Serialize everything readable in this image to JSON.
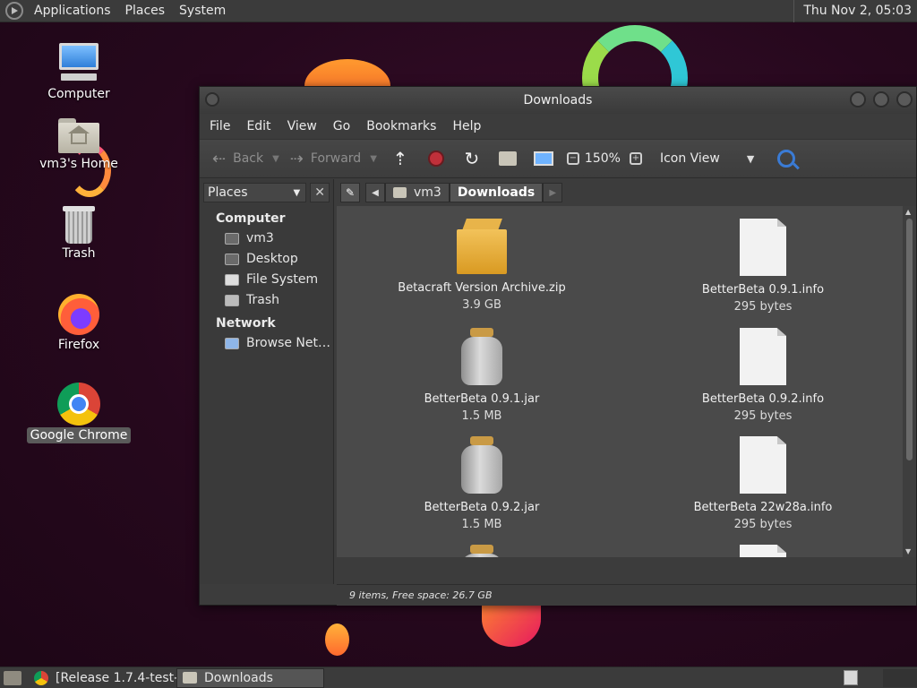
{
  "top_panel": {
    "menus": [
      "Applications",
      "Places",
      "System"
    ],
    "clock": "Thu Nov  2, 05:03"
  },
  "desktop": {
    "icons": [
      {
        "label": "Computer",
        "icon": "computer-icon"
      },
      {
        "label": "vm3's Home",
        "icon": "home-folder-icon"
      },
      {
        "label": "Trash",
        "icon": "trash-icon"
      },
      {
        "label": "Firefox",
        "icon": "firefox-icon"
      },
      {
        "label": "Google Chrome",
        "icon": "chrome-icon",
        "selected": true
      }
    ]
  },
  "window": {
    "title": "Downloads",
    "menubar": [
      "File",
      "Edit",
      "View",
      "Go",
      "Bookmarks",
      "Help"
    ],
    "toolbar": {
      "back_label": "Back",
      "forward_label": "Forward",
      "zoom": "150%",
      "view_mode": "Icon View"
    },
    "sidebar": {
      "selector_label": "Places",
      "sections": [
        {
          "title": "Computer",
          "items": [
            "vm3",
            "Desktop",
            "File System",
            "Trash"
          ]
        },
        {
          "title": "Network",
          "items": [
            "Browse Net…"
          ]
        }
      ]
    },
    "pathbar": {
      "crumbs": [
        "vm3",
        "Downloads"
      ]
    },
    "files": [
      {
        "name": "Betacraft Version Archive.zip",
        "size": "3.9 GB",
        "icon": "archive-box-icon"
      },
      {
        "name": "BetterBeta 0.9.1.info",
        "size": "295 bytes",
        "icon": "document-icon"
      },
      {
        "name": "BetterBeta 0.9.1.jar",
        "size": "1.5 MB",
        "icon": "jar-icon"
      },
      {
        "name": "BetterBeta 0.9.2.info",
        "size": "295 bytes",
        "icon": "document-icon"
      },
      {
        "name": "BetterBeta 0.9.2.jar",
        "size": "1.5 MB",
        "icon": "jar-icon"
      },
      {
        "name": "BetterBeta 22w28a.info",
        "size": "295 bytes",
        "icon": "document-icon"
      },
      {
        "name": "",
        "size": "",
        "icon": "jar-icon"
      },
      {
        "name": "",
        "size": "",
        "icon": "document-icon"
      }
    ],
    "status": "9 items, Free space: 26.7 GB"
  },
  "taskbar": {
    "tasks": [
      {
        "label": "[Release 1.7.4-test-...",
        "icon": "chrome-icon"
      },
      {
        "label": "Downloads",
        "icon": "folder-icon",
        "active": true
      }
    ]
  }
}
